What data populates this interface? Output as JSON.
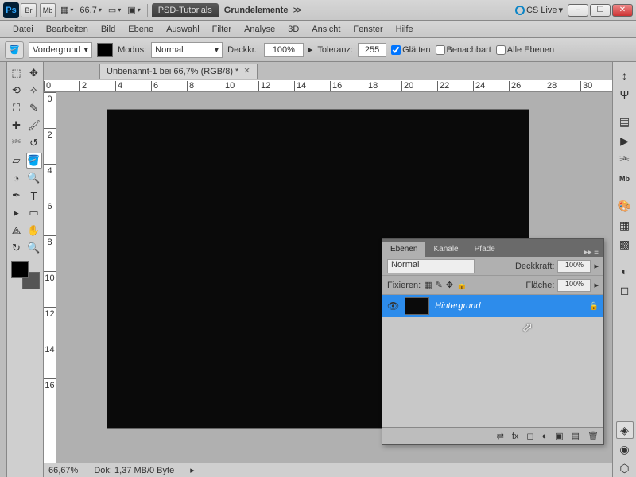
{
  "titlebar": {
    "zoom": "66,7",
    "tabs": [
      "PSD-Tutorials",
      "Grundelemente"
    ],
    "cslive": "CS Live"
  },
  "menu": [
    "Datei",
    "Bearbeiten",
    "Bild",
    "Ebene",
    "Auswahl",
    "Filter",
    "Analyse",
    "3D",
    "Ansicht",
    "Fenster",
    "Hilfe"
  ],
  "options": {
    "fill": "Vordergrund",
    "mode_label": "Modus:",
    "mode": "Normal",
    "opacity_label": "Deckkr.:",
    "opacity": "100%",
    "tolerance_label": "Toleranz:",
    "tolerance": "255",
    "antialias": "Glätten",
    "contiguous": "Benachbart",
    "alllayers": "Alle Ebenen"
  },
  "document": {
    "tab": "Unbenannt-1 bei 66,7% (RGB/8) *",
    "zoom": "66,67%",
    "status": "Dok: 1,37 MB/0 Byte"
  },
  "ruler_h": [
    "0",
    "2",
    "4",
    "6",
    "8",
    "10",
    "12",
    "14",
    "16",
    "18",
    "20",
    "22",
    "24",
    "26",
    "28",
    "30"
  ],
  "ruler_v": [
    "0",
    "2",
    "4",
    "6",
    "8",
    "10",
    "12",
    "14",
    "16"
  ],
  "layers_panel": {
    "tabs": [
      "Ebenen",
      "Kanäle",
      "Pfade"
    ],
    "blend": "Normal",
    "opacity_label": "Deckkraft:",
    "opacity": "100%",
    "lock_label": "Fixieren:",
    "fill_label": "Fläche:",
    "fill": "100%",
    "layers": [
      {
        "name": "Hintergrund",
        "locked": true
      }
    ]
  },
  "chart_data": null
}
